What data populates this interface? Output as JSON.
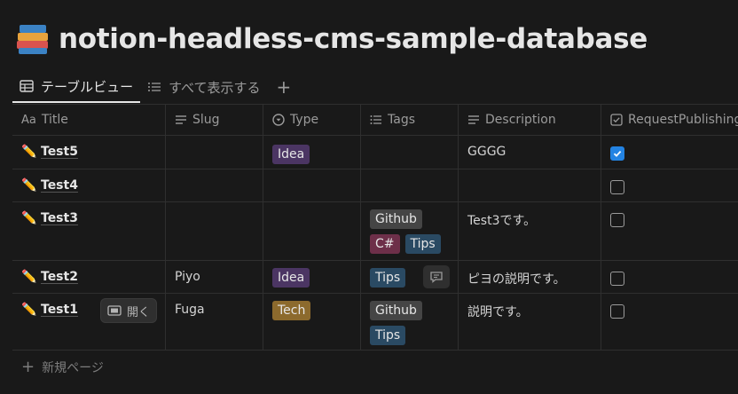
{
  "page": {
    "title": "notion-headless-cms-sample-database",
    "icon": "books-icon"
  },
  "tabs": [
    {
      "label": "テーブルビュー",
      "icon": "table-icon",
      "active": true
    },
    {
      "label": "すべて表示する",
      "icon": "list-icon",
      "active": false
    }
  ],
  "add_view_label": "+",
  "columns": [
    {
      "label": "Title",
      "icon": "Aa"
    },
    {
      "label": "Slug",
      "icon": "text-icon"
    },
    {
      "label": "Type",
      "icon": "select-icon"
    },
    {
      "label": "Tags",
      "icon": "multi-select-icon"
    },
    {
      "label": "Description",
      "icon": "text-icon"
    },
    {
      "label": "RequestPublishing",
      "icon": "checkbox-icon"
    }
  ],
  "rows": [
    {
      "title": "Test5",
      "slug": "",
      "type": "Idea",
      "tags": [],
      "description": "GGGG",
      "request": true
    },
    {
      "title": "Test4",
      "slug": "",
      "type": "",
      "tags": [],
      "description": "",
      "request": false
    },
    {
      "title": "Test3",
      "slug": "",
      "type": "",
      "tags": [
        "Github",
        "C#",
        "Tips"
      ],
      "description": "Test3です。",
      "request": false
    },
    {
      "title": "Test2",
      "slug": "Piyo",
      "type": "Idea",
      "tags": [
        "Tips"
      ],
      "description": "ピヨの説明です。",
      "request": false
    },
    {
      "title": "Test1",
      "slug": "Fuga",
      "type": "Tech",
      "tags": [
        "Github",
        "Tips"
      ],
      "description": "説明です。",
      "request": false
    }
  ],
  "open_button_label": "開く",
  "new_page_label": "新規ページ",
  "colors": {
    "accent": "#2383e2",
    "background": "#191919"
  }
}
